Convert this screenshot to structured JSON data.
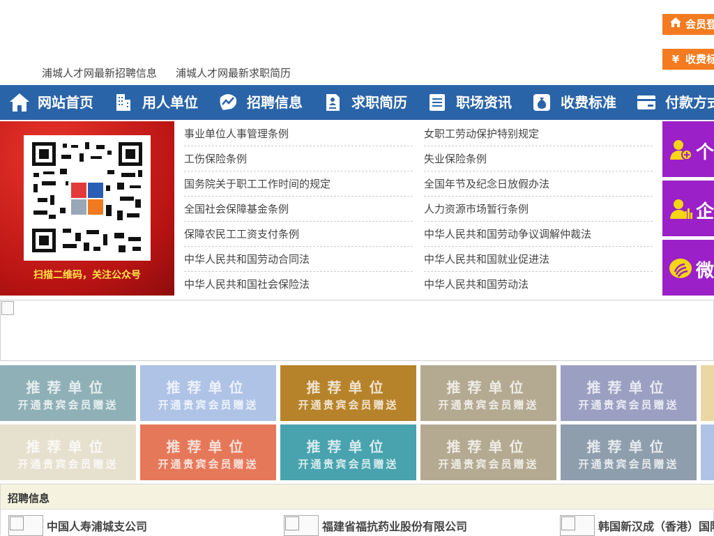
{
  "header": {
    "links": [
      "浦城人才网最新招聘信息",
      "浦城人才网最新求职简历"
    ],
    "member_login": "会员登",
    "fee_standard": "收费标"
  },
  "nav": {
    "items": [
      {
        "label": "网站首页",
        "icon": "home-icon"
      },
      {
        "label": "用人单位",
        "icon": "building-icon"
      },
      {
        "label": "招聘信息",
        "icon": "chart-icon"
      },
      {
        "label": "求职简历",
        "icon": "resume-icon"
      },
      {
        "label": "职场资讯",
        "icon": "news-icon"
      },
      {
        "label": "收费标准",
        "icon": "money-bag-icon"
      },
      {
        "label": "付款方式",
        "icon": "card-icon"
      }
    ]
  },
  "promo": {
    "caption": "扫描二维码，关注公众号"
  },
  "laws": {
    "left": [
      "事业单位人事管理条例",
      "工伤保险条例",
      "国务院关于职工工作时间的规定",
      "全国社会保障基金条例",
      "保障农民工工资支付条例",
      "中华人民共和国劳动合同法",
      "中华人民共和国社会保险法"
    ],
    "right": [
      "女职工劳动保护特别规定",
      "失业保险条例",
      "全国年节及纪念日放假办法",
      "人力资源市场暂行条例",
      "中华人民共和国劳动争议调解仲裁法",
      "中华人民共和国就业促进法",
      "中华人民共和国劳动法"
    ]
  },
  "side": {
    "tiles": [
      {
        "label": "个",
        "icon": "person-add-icon"
      },
      {
        "label": "企",
        "icon": "company-icon"
      },
      {
        "label": "微",
        "icon": "wechat-icon"
      }
    ]
  },
  "recommend": {
    "line1": "推荐单位",
    "line2": "开通贵宾会员赠送",
    "colors": [
      "#8fb0b7",
      "#aec3e6",
      "#b7832a",
      "#b4aa91",
      "#9ba0c2",
      "#ead7a3",
      "#e6e0cf",
      "#e6785a",
      "#48a3ae",
      "#b4aa91",
      "#8f9ead",
      "#aec3e6"
    ]
  },
  "jobs": {
    "title": "招聘信息",
    "items": [
      "中国人寿浦城支公司",
      "福建省福抗药业股份有限公司",
      "韩国新汉成（香港）国际"
    ]
  }
}
